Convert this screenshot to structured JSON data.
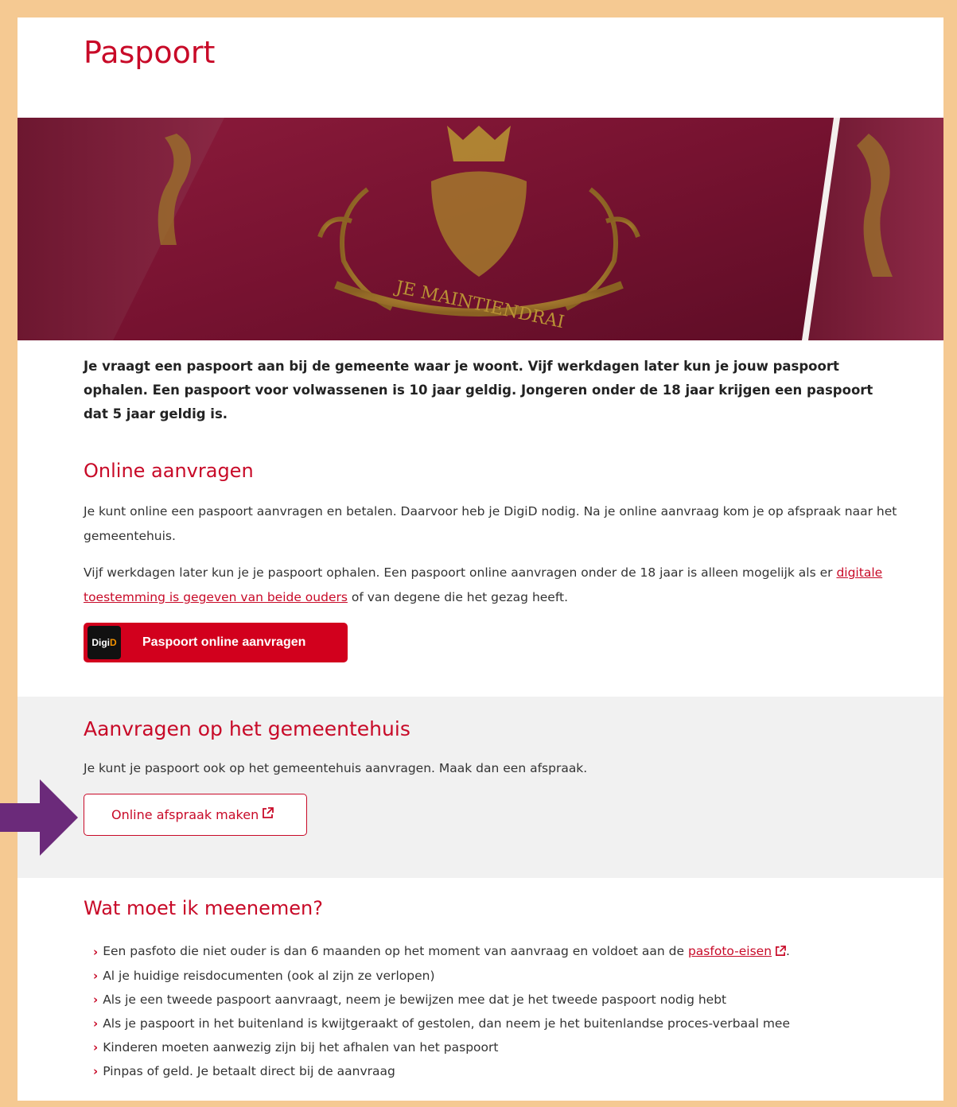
{
  "page": {
    "title": "Paspoort",
    "hero_image_alt": "Nederlandse paspoorten met het wapen en de tekst JE MAINTIENDRAI",
    "hero_motto": "JE MAINTIENDRAI",
    "intro": "Je vraagt een paspoort aan bij de gemeente waar je woont. Vijf werkdagen later kun je jouw paspoort ophalen. Een paspoort voor volwassenen is 10 jaar geldig. Jongeren onder de 18 jaar krijgen een paspoort dat 5 jaar geldig is."
  },
  "online": {
    "heading": "Online aanvragen",
    "p1": "Je kunt online een paspoort aanvragen en betalen. Daarvoor heb je DigiD nodig. Na je online aanvraag kom je op afspraak naar het gemeentehuis.",
    "p2_before": "Vijf werkdagen later kun je je paspoort ophalen. Een paspoort online aanvragen onder de 18 jaar is alleen mogelijk als er ",
    "p2_link": "digitale toestemming is gegeven van beide ouders",
    "p2_after": " of van degene die het gezag heeft.",
    "digid_logo_main": "Digi",
    "digid_logo_accent": "D",
    "button_label": "Paspoort online aanvragen"
  },
  "gemeentehuis": {
    "heading": "Aanvragen op het gemeentehuis",
    "text": "Je kunt je paspoort ook op het gemeentehuis aanvragen. Maak dan een afspraak.",
    "button_label": "Online afspraak maken"
  },
  "meenemen": {
    "heading": "Wat moet ik meenemen?",
    "item1_before": "Een pasfoto die niet ouder is dan 6 maanden op het moment van aanvraag en voldoet aan de ",
    "item1_link": "pasfoto-eisen",
    "item1_after": ".",
    "items": [
      "Al je huidige reisdocumenten (ook al zijn ze verlopen)",
      "Als je een tweede paspoort aanvraagt, neem je bewijzen mee dat je het tweede paspoort nodig hebt",
      "Als je paspoort in het buitenland is kwijtgeraakt of gestolen, dan neem je het buitenlandse proces-verbaal mee",
      "Kinderen moeten aanwezig zijn bij het afhalen van het paspoort",
      "Pinpas of geld. Je betaalt direct bij de aanvraag"
    ]
  },
  "colors": {
    "brand_red": "#c80a28",
    "frame_orange": "#f5c992",
    "annotation_purple": "#6b2a7a"
  },
  "icons": {
    "chevron": "›",
    "external": "external-link-icon"
  }
}
